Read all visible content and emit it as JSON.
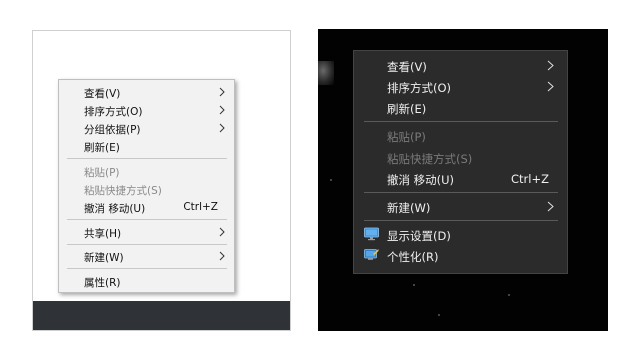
{
  "light_menu": {
    "items": [
      {
        "label": "查看(V)",
        "submenu": true
      },
      {
        "label": "排序方式(O)",
        "submenu": true
      },
      {
        "label": "分组依据(P)",
        "submenu": true
      },
      {
        "label": "刷新(E)"
      },
      {
        "label": "粘贴(P)",
        "disabled": true
      },
      {
        "label": "粘贴快捷方式(S)",
        "disabled": true
      },
      {
        "label": "撤消 移动(U)",
        "shortcut": "Ctrl+Z"
      },
      {
        "label": "共享(H)",
        "submenu": true
      },
      {
        "label": "新建(W)",
        "submenu": true
      },
      {
        "label": "属性(R)"
      }
    ]
  },
  "dark_menu": {
    "items": [
      {
        "label": "查看(V)",
        "submenu": true
      },
      {
        "label": "排序方式(O)",
        "submenu": true
      },
      {
        "label": "刷新(E)"
      },
      {
        "label": "粘贴(P)",
        "disabled": true
      },
      {
        "label": "粘贴快捷方式(S)",
        "disabled": true
      },
      {
        "label": "撤消 移动(U)",
        "shortcut": "Ctrl+Z"
      },
      {
        "label": "新建(W)",
        "submenu": true
      },
      {
        "label": "显示设置(D)",
        "icon": "display-settings-icon"
      },
      {
        "label": "个性化(R)",
        "icon": "personalize-icon"
      }
    ]
  },
  "colors": {
    "light_menu_bg": "#f2f2f2",
    "dark_menu_bg": "#2b2b2b",
    "desktop_dark_bg": "#020202",
    "taskbar": "#2f3337"
  }
}
